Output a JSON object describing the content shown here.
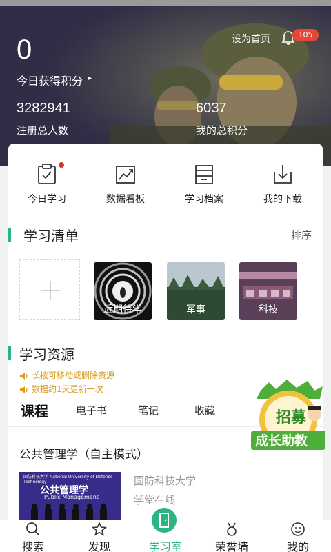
{
  "header": {
    "today_score": "0",
    "today_label": "今日获得积分",
    "set_home": "设为首页",
    "notification_count": "105",
    "stats": [
      {
        "value": "3282941",
        "label": "注册总人数"
      },
      {
        "value": "6037",
        "label": "我的总积分"
      }
    ]
  },
  "quick_actions": [
    {
      "label": "今日学习",
      "icon": "clipboard-check-icon",
      "has_dot": true
    },
    {
      "label": "数据看板",
      "icon": "trend-chart-icon"
    },
    {
      "label": "学习档案",
      "icon": "archive-box-icon"
    },
    {
      "label": "我的下载",
      "icon": "download-tray-icon"
    }
  ],
  "study_list": {
    "title": "学习清单",
    "sort_label": "排序",
    "tiles": [
      "近期待学",
      "军事",
      "科技"
    ]
  },
  "resources": {
    "title": "学习资源",
    "tips": [
      "长按可移动或删除资源",
      "数据约1天更新一次"
    ],
    "tabs": [
      "课程",
      "电子书",
      "笔记",
      "收藏"
    ]
  },
  "course": {
    "title": "公共管理学（自主模式）",
    "org": "国防科技大学",
    "school": "学堂在线",
    "thumb_small": "国防科技大学 National University of Defense Technology",
    "thumb_title": "公共管理学",
    "thumb_sub": "Public Management"
  },
  "promo": {
    "line1": "招募",
    "line2": "成长助教"
  },
  "nav": {
    "items": [
      "搜索",
      "发现",
      "学习室",
      "荣誉墙",
      "我的"
    ],
    "active_index": 2
  },
  "colors": {
    "accent": "#2bb583",
    "hero_bg": "#2f2e46",
    "badge": "#e5483b",
    "tip": "#d79a1c"
  }
}
